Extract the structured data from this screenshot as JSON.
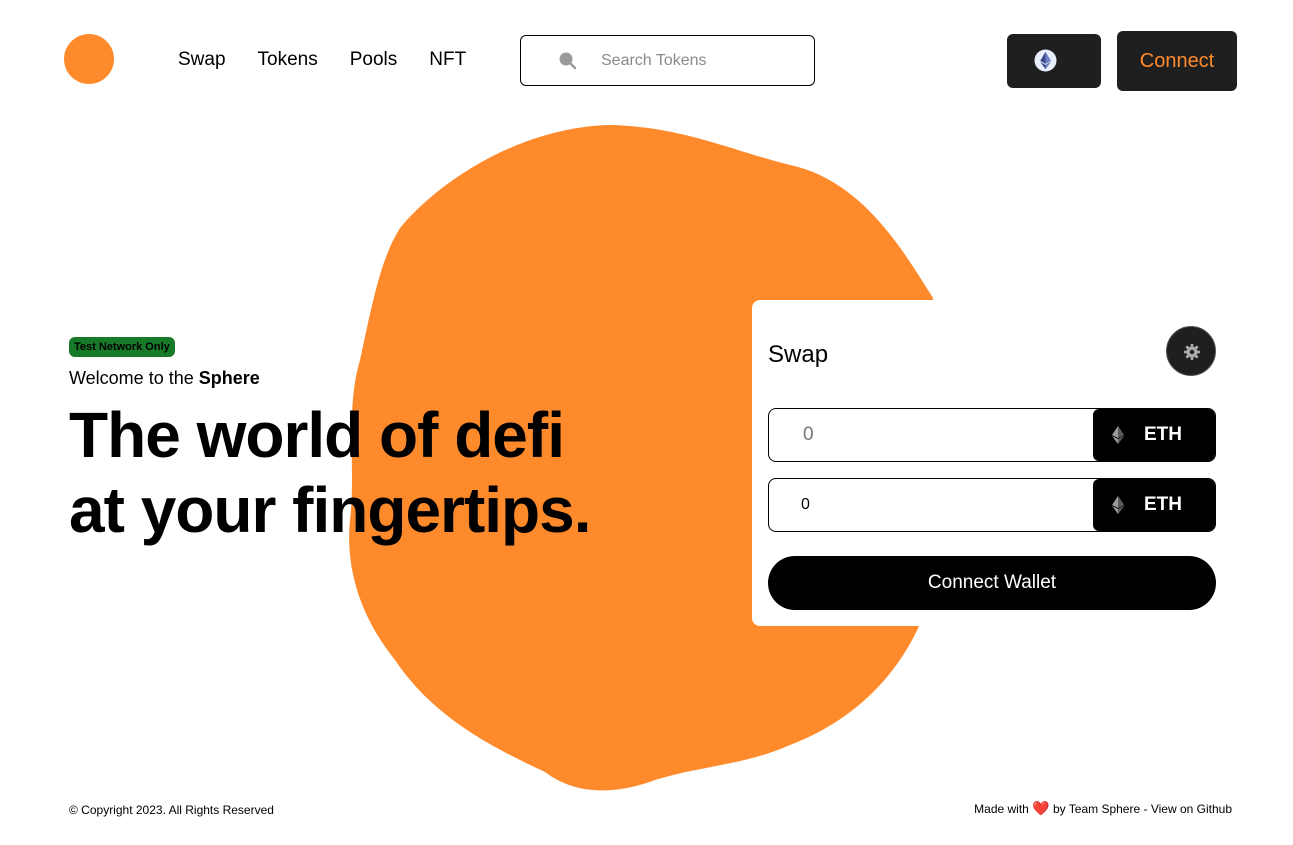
{
  "colors": {
    "accent": "#FF8A2B",
    "dark": "#1f1f1f",
    "badge_green": "#177a28"
  },
  "header": {
    "logo_icon": "orange-circle-logo",
    "nav": [
      "Swap",
      "Tokens",
      "Pools",
      "NFT"
    ],
    "search": {
      "placeholder": "Search Tokens",
      "icon": "search-icon"
    },
    "network_icon": "ethereum-icon",
    "connect_label": "Connect"
  },
  "hero": {
    "badge": "Test Network Only",
    "welcome_prefix": "Welcome to the ",
    "welcome_brand": "Sphere",
    "headline_line1": "The world of defi",
    "headline_line2": "at your fingertips."
  },
  "swap": {
    "title": "Swap",
    "settings_icon": "gear-icon",
    "rows": [
      {
        "placeholder": "0",
        "value": "",
        "token": "ETH"
      },
      {
        "placeholder": "",
        "value": "0",
        "token": "ETH"
      }
    ],
    "wallet_button": "Connect Wallet"
  },
  "footer": {
    "copyright": "© Copyright 2023. All Rights Reserved",
    "made_prefix": "Made with",
    "heart": "❤️",
    "made_by": "by Team Sphere -",
    "github_link": "View on Github"
  }
}
